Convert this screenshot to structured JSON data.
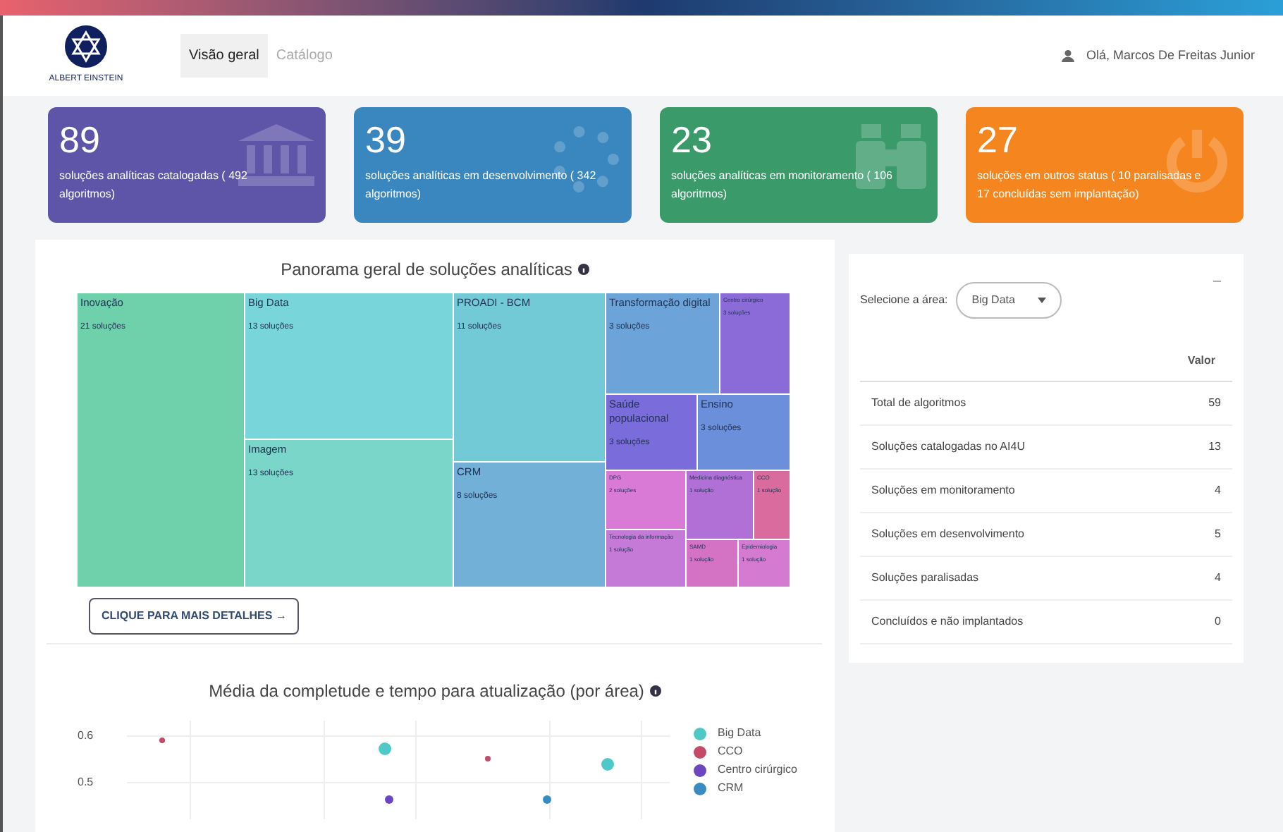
{
  "header": {
    "logo_text": "ALBERT EINSTEIN",
    "tabs": [
      {
        "label": "Visão geral",
        "selected": true
      },
      {
        "label": "Catálogo",
        "selected": false
      }
    ],
    "greeting": "Olá, Marcos De Freitas Junior"
  },
  "cards": [
    {
      "number": "89",
      "text": "soluções analíticas catalogadas ( 492 algoritmos)",
      "color": "#5f55a8",
      "kind": "bank"
    },
    {
      "number": "39",
      "text": "soluções analíticas em desenvolvimento ( 342 algoritmos)",
      "color": "#3a87bf",
      "kind": "spinner"
    },
    {
      "number": "23",
      "text": "soluções analíticas em monitoramento ( 106 algoritmos)",
      "color": "#3a9a6a",
      "kind": "binoculars"
    },
    {
      "number": "27",
      "text": "soluções em outros status ( 10 paralisadas e 17 concluídas sem implantação)",
      "color": "#f5851f",
      "kind": "power"
    }
  ],
  "treemap": {
    "title": "Panorama geral de soluções analíticas",
    "tiles": [
      {
        "name": "Inovação",
        "count": "21 soluções",
        "color": "#6fd1ac"
      },
      {
        "name": "Big Data",
        "count": "13 soluções",
        "color": "#78d6da"
      },
      {
        "name": "Imagem",
        "count": "13 soluções",
        "color": "#79d6c8"
      },
      {
        "name": "PROADI - BCM",
        "count": "11 soluções",
        "color": "#72cad6"
      },
      {
        "name": "CRM",
        "count": "8 soluções",
        "color": "#72b0d8"
      },
      {
        "name": "Transformação digital",
        "count": "3 soluções",
        "color": "#6ca3d8"
      },
      {
        "name": "Centro cirúrgico",
        "count": "3 soluções",
        "color": "#8a6bd8"
      },
      {
        "name": "Saúde populacional",
        "count": "3 soluções",
        "color": "#7a6ddb"
      },
      {
        "name": "Ensino",
        "count": "3 soluções",
        "color": "#6b8fdb"
      },
      {
        "name": "DPG",
        "count": "2 soluções",
        "color": "#d97ad6"
      },
      {
        "name": "Medicina diagnóstica",
        "count": "1 solução",
        "color": "#b070d6"
      },
      {
        "name": "CCO",
        "count": "1 solução",
        "color": "#d96b9e"
      },
      {
        "name": "Tecnologia da informação",
        "count": "1 solução",
        "color": "#c67ad8"
      },
      {
        "name": "SAMD",
        "count": "1 solução",
        "color": "#d473c4"
      },
      {
        "name": "Epidemiologia",
        "count": "1 solução",
        "color": "#d47ad0"
      }
    ],
    "button": "CLIQUE PARA MAIS DETALHES →"
  },
  "area_panel": {
    "select_label": "Selecione a área:",
    "select_value": "Big Data",
    "collapse": "–",
    "column": "Valor",
    "rows": [
      {
        "label": "Total de algoritmos",
        "value": "59"
      },
      {
        "label": "Soluções catalogadas no AI4U",
        "value": "13"
      },
      {
        "label": "Soluções em monitoramento",
        "value": "4"
      },
      {
        "label": "Soluções em desenvolvimento",
        "value": "5"
      },
      {
        "label": "Soluções paralisadas",
        "value": "4"
      },
      {
        "label": "Concluídos e não implantados",
        "value": "0"
      }
    ]
  },
  "scatter": {
    "title": "Média da completude e tempo para atualização (por área)",
    "y_ticks": [
      "0.6",
      "0.5"
    ],
    "legend": [
      {
        "name": "Big Data",
        "color": "#4fc8c8"
      },
      {
        "name": "CCO",
        "color": "#c44a6a"
      },
      {
        "name": "Centro cirúrgico",
        "color": "#6b46c1"
      },
      {
        "name": "CRM",
        "color": "#3a8bbf"
      }
    ]
  }
}
